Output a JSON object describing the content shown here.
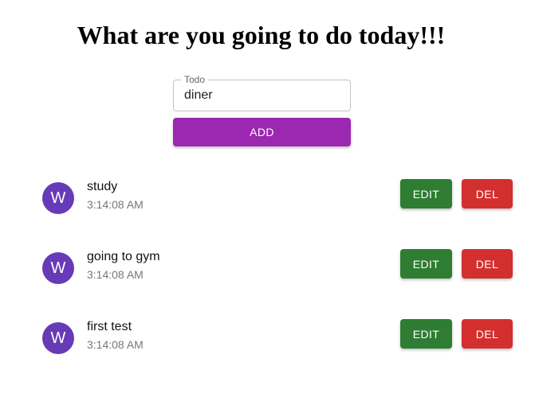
{
  "header": {
    "title": "What are you going to do today!!!"
  },
  "form": {
    "label": "Todo",
    "value": "diner",
    "add_label": "ADD"
  },
  "todos": [
    {
      "avatar": "W",
      "text": "study",
      "time": "3:14:08 AM",
      "edit_label": "EDIT",
      "delete_label": "DEL"
    },
    {
      "avatar": "W",
      "text": "going to gym",
      "time": "3:14:08 AM",
      "edit_label": "EDIT",
      "delete_label": "DEL"
    },
    {
      "avatar": "W",
      "text": "first test",
      "time": "3:14:08 AM",
      "edit_label": "EDIT",
      "delete_label": "DEL"
    }
  ],
  "colors": {
    "add_button": "#9c27b0",
    "avatar": "#673ab7",
    "edit_button": "#2e7d32",
    "delete_button": "#d32f2f"
  }
}
